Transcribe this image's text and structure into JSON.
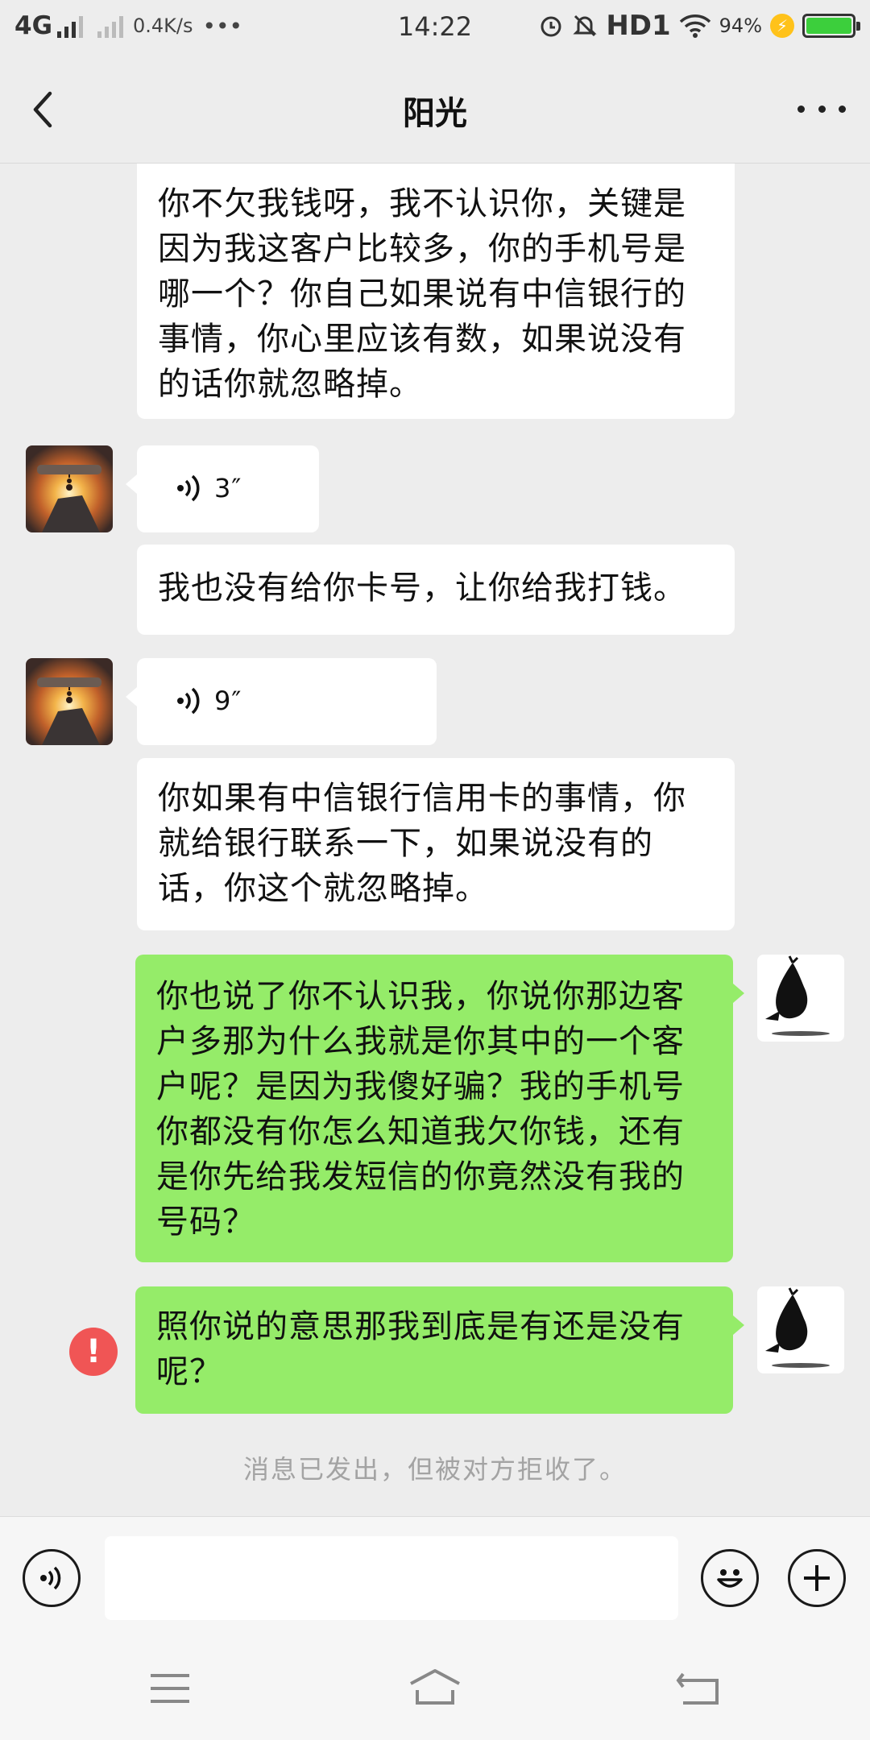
{
  "status_bar": {
    "network": "4G",
    "speed": "0.4K/s",
    "more": "•••",
    "time": "14:22",
    "hd": "HD1",
    "battery_percent": "94%",
    "battery_level": 0.94
  },
  "header": {
    "title": "阳光",
    "back_icon": "chevron-left-icon",
    "more_icon": "more-dots-icon"
  },
  "messages": [
    {
      "side": "left",
      "type": "text",
      "text": "你不欠我钱呀，我不认识你，关键是因为我这客户比较多，你的手机号是哪一个？你自己如果说有中信银行的事情，你心里应该有数，如果说没有的话你就忽略掉。"
    },
    {
      "side": "left",
      "type": "voice",
      "duration": "3″"
    },
    {
      "side": "left",
      "type": "text",
      "text": "我也没有给你卡号，让你给我打钱。"
    },
    {
      "side": "left",
      "type": "voice",
      "duration": "9″"
    },
    {
      "side": "left",
      "type": "text",
      "text": "你如果有中信银行信用卡的事情，你就给银行联系一下，如果说没有的话，你这个就忽略掉。"
    },
    {
      "side": "right",
      "type": "text",
      "text": "你也说了你不认识我，你说你那边客户多那为什么我就是你其中的一个客户呢？是因为我傻好骗？我的手机号你都没有你怎么知道我欠你钱，还有是你先给我发短信的你竟然没有我的号码？"
    },
    {
      "side": "right",
      "type": "text",
      "text": "照你说的意思那我到底是有还是没有呢？",
      "status": "failed"
    }
  ],
  "system_note": "消息已发出，但被对方拒收了。",
  "input_bar": {
    "voice_icon": "voice-mode-icon",
    "emoji_icon": "emoji-icon",
    "plus_icon": "plus-icon",
    "text_value": ""
  },
  "nav_bar": {
    "menu_icon": "menu-icon",
    "home_icon": "home-icon",
    "back_icon": "back-icon"
  },
  "colors": {
    "background": "#ededed",
    "sent_bubble": "#95ec69",
    "received_bubble": "#ffffff",
    "error": "#f05555",
    "battery": "#3ccf3c"
  }
}
